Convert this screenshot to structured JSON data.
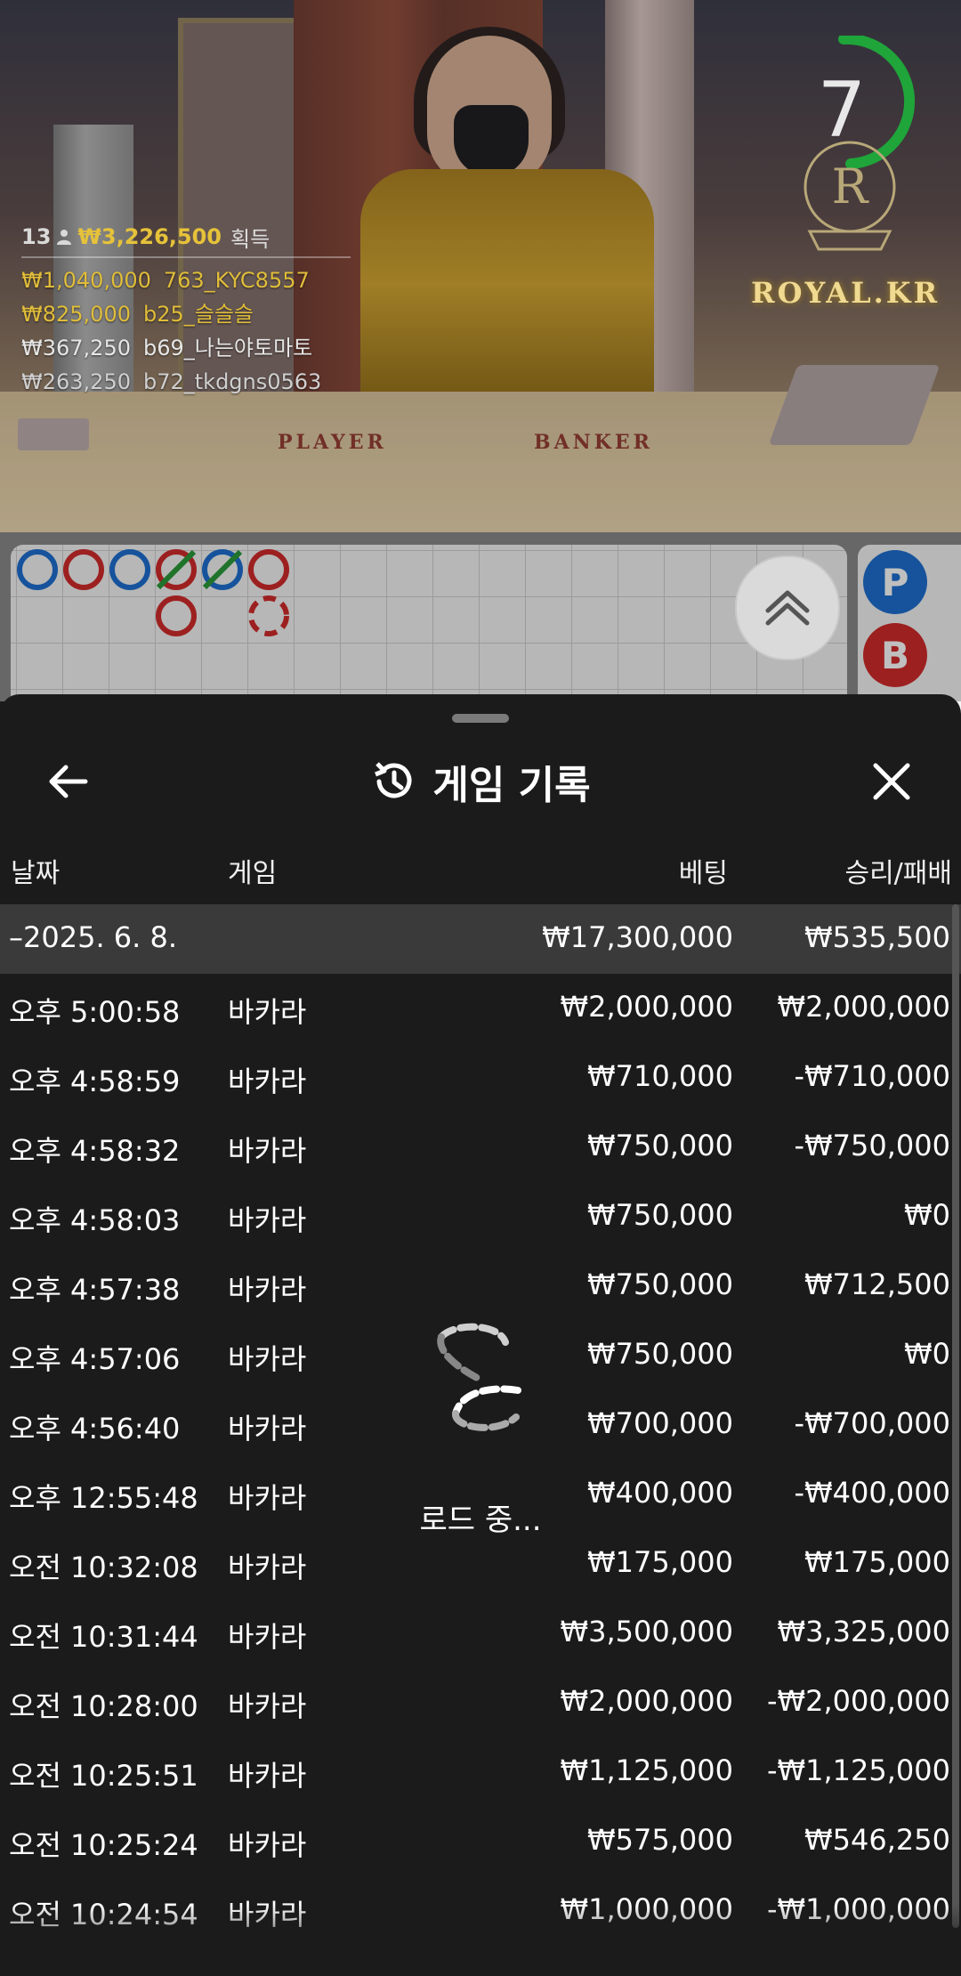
{
  "video": {
    "timer_value": "7",
    "brand": "ROYAL.KR",
    "table_labels": [
      "PLAYER",
      "BANKER"
    ],
    "ranking": {
      "count": "13",
      "total": "₩3,226,500",
      "label": "획득",
      "rows": [
        {
          "amount": "₩1,040,000",
          "user": "763_KYC8557"
        },
        {
          "amount": "₩825,000",
          "user": "b25_슬슬슬"
        },
        {
          "amount": "₩367,250",
          "user": "b69_나는야토마토"
        },
        {
          "amount": "₩263,250",
          "user": "b72_tkdgns0563"
        }
      ]
    }
  },
  "road": {
    "side_labels": [
      "P",
      "B"
    ],
    "colors": {
      "player": "#1e6fd0",
      "banker": "#d22b2b",
      "tie": "#2a9a3a"
    }
  },
  "sheet": {
    "title": "게임 기록",
    "columns": {
      "date": "날짜",
      "game": "게임",
      "bet": "베팅",
      "result": "승리/패배"
    },
    "day": {
      "date": "–2025. 6. 8.",
      "bet": "₩17,300,000",
      "result": "₩535,500"
    },
    "rows": [
      {
        "time": "오후 5:00:58",
        "game": "바카라",
        "bet": "₩2,000,000",
        "result": "₩2,000,000"
      },
      {
        "time": "오후 4:58:59",
        "game": "바카라",
        "bet": "₩710,000",
        "result": "-₩710,000"
      },
      {
        "time": "오후 4:58:32",
        "game": "바카라",
        "bet": "₩750,000",
        "result": "-₩750,000"
      },
      {
        "time": "오후 4:58:03",
        "game": "바카라",
        "bet": "₩750,000",
        "result": "₩0"
      },
      {
        "time": "오후 4:57:38",
        "game": "바카라",
        "bet": "₩750,000",
        "result": "₩712,500"
      },
      {
        "time": "오후 4:57:06",
        "game": "바카라",
        "bet": "₩750,000",
        "result": "₩0"
      },
      {
        "time": "오후 4:56:40",
        "game": "바카라",
        "bet": "₩700,000",
        "result": "-₩700,000"
      },
      {
        "time": "오후 12:55:48",
        "game": "바카라",
        "bet": "₩400,000",
        "result": "-₩400,000"
      },
      {
        "time": "오전 10:32:08",
        "game": "바카라",
        "bet": "₩175,000",
        "result": "₩175,000"
      },
      {
        "time": "오전 10:31:44",
        "game": "바카라",
        "bet": "₩3,500,000",
        "result": "₩3,325,000"
      },
      {
        "time": "오전 10:28:00",
        "game": "바카라",
        "bet": "₩2,000,000",
        "result": "-₩2,000,000"
      },
      {
        "time": "오전 10:25:51",
        "game": "바카라",
        "bet": "₩1,125,000",
        "result": "-₩1,125,000"
      },
      {
        "time": "오전 10:25:24",
        "game": "바카라",
        "bet": "₩575,000",
        "result": "₩546,250"
      },
      {
        "time": "오전 10:24:54",
        "game": "바카라",
        "bet": "₩1,000,000",
        "result": "-₩1,000,000"
      }
    ],
    "loading_text": "로드 중..."
  }
}
